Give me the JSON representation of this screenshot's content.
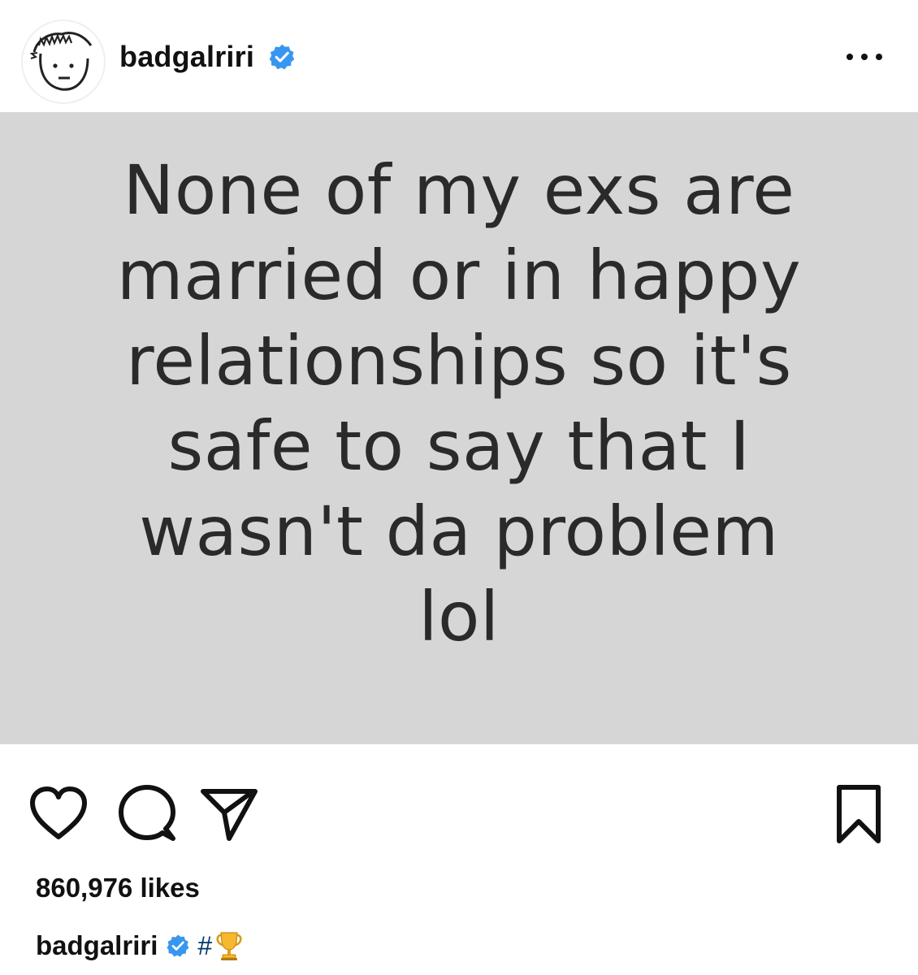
{
  "header": {
    "username": "badgalriri",
    "verified": true
  },
  "post": {
    "quote": "None of my exs are\nmarried or in happy\nrelationships so it's\nsafe to say that I\nwasn't da problem\nlol",
    "background": "#d6d6d6"
  },
  "actions": {
    "icons": [
      "heart-icon",
      "comment-icon",
      "share-icon",
      "bookmark-icon"
    ]
  },
  "likes": {
    "text": "860,976 likes"
  },
  "caption": {
    "username": "badgalriri",
    "hashtag": "#",
    "emoji": "trophy-icon"
  },
  "colors": {
    "verified_blue": "#3797f0",
    "link_blue": "#00376b",
    "text": "#111111"
  }
}
